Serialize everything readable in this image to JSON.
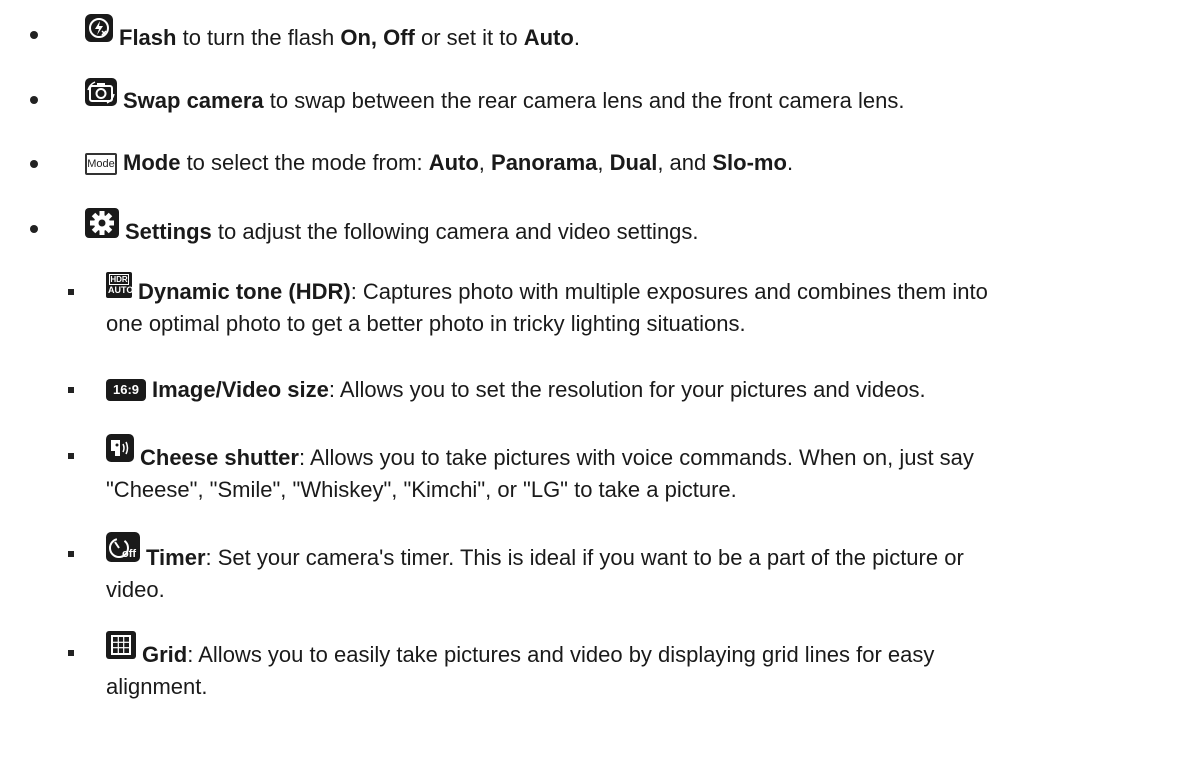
{
  "items": [
    {
      "icon": "flash-icon",
      "term": "Flash",
      "rest": [
        " to turn the flash ",
        "On, Off",
        " or set it to ",
        "Auto",
        "."
      ]
    },
    {
      "icon": "swap-camera-icon",
      "term": "Swap camera",
      "rest": " to swap between the rear camera lens and the front camera lens."
    },
    {
      "icon": "mode-icon",
      "icon_text": "Mode",
      "term": "Mode",
      "rest": [
        " to select the mode from: ",
        "Auto",
        ", ",
        "Panorama",
        ", ",
        "Dual",
        ", and ",
        "Slo-mo",
        "."
      ]
    },
    {
      "icon": "gear-icon",
      "term": "Settings",
      "rest": " to adjust the following camera and video settings."
    }
  ],
  "settings": [
    {
      "icon": "hdr-auto-icon",
      "icon_text_top": "HDR",
      "icon_text_bottom": "AUTO",
      "term": "Dynamic tone (HDR)",
      "line1": ": Captures photo with multiple exposures and combines them into",
      "line2": "one optimal photo to get a better photo in tricky lighting situations."
    },
    {
      "icon": "aspect-ratio-icon",
      "icon_text": "16:9",
      "term": "Image/Video size",
      "line1": ": Allows you to set the resolution for your pictures and videos."
    },
    {
      "icon": "cheese-shutter-icon",
      "term": "Cheese shutter",
      "line1": ": Allows you to take pictures with voice commands. When on, just say",
      "line2": "\"Cheese\", \"Smile\", \"Whiskey\", \"Kimchi\", or \"LG\" to take a picture."
    },
    {
      "icon": "timer-off-icon",
      "icon_text": "off",
      "term": "Timer",
      "line1": ": Set your camera's timer. This is ideal if you want to be a part of the picture or",
      "line2": "video."
    },
    {
      "icon": "grid-icon",
      "term": "Grid",
      "line1": ": Allows you to easily take pictures and video by displaying grid lines for easy",
      "line2": "alignment."
    }
  ]
}
